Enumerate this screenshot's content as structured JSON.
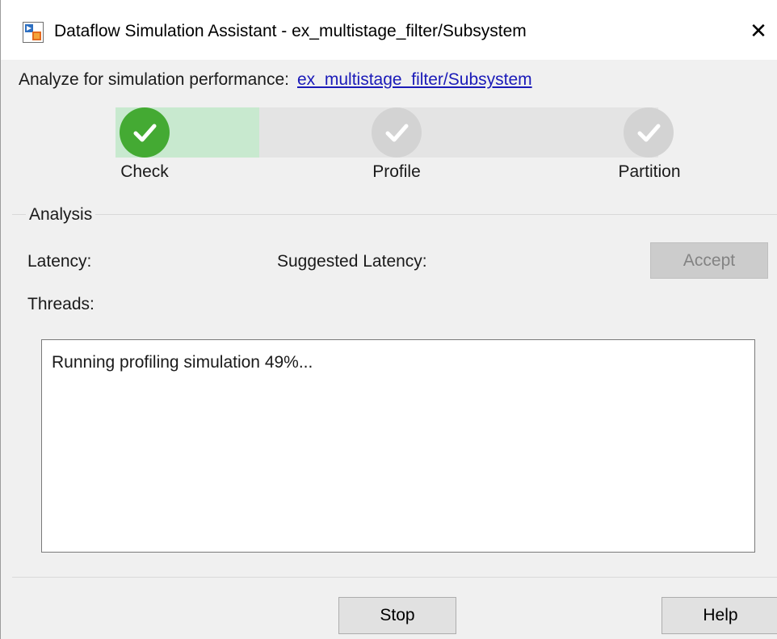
{
  "window": {
    "title": "Dataflow Simulation Assistant - ex_multistage_filter/Subsystem",
    "app_icon": "simulink-model-icon",
    "close_icon": "close-icon",
    "close_glyph": "✕"
  },
  "analyze": {
    "label": "Analyze for simulation performance:",
    "link": "ex_multistage_filter/Subsystem"
  },
  "steps": {
    "progress_fraction": 0.265,
    "items": [
      {
        "label": "Check",
        "state": "done"
      },
      {
        "label": "Profile",
        "state": "pending"
      },
      {
        "label": "Partition",
        "state": "pending"
      }
    ]
  },
  "analysis": {
    "group_label": "Analysis",
    "latency_label": "Latency:",
    "suggested_latency_label": "Suggested Latency:",
    "threads_label": "Threads:",
    "accept_label": "Accept",
    "accept_enabled": false,
    "log_text": "Running profiling simulation 49%..."
  },
  "footer": {
    "stop_label": "Stop",
    "help_label": "Help"
  },
  "colors": {
    "step_done": "#44aa33",
    "step_pending": "#d3d3d3",
    "progress_fill": "#c8e9cf",
    "link": "#1a1ab8"
  }
}
